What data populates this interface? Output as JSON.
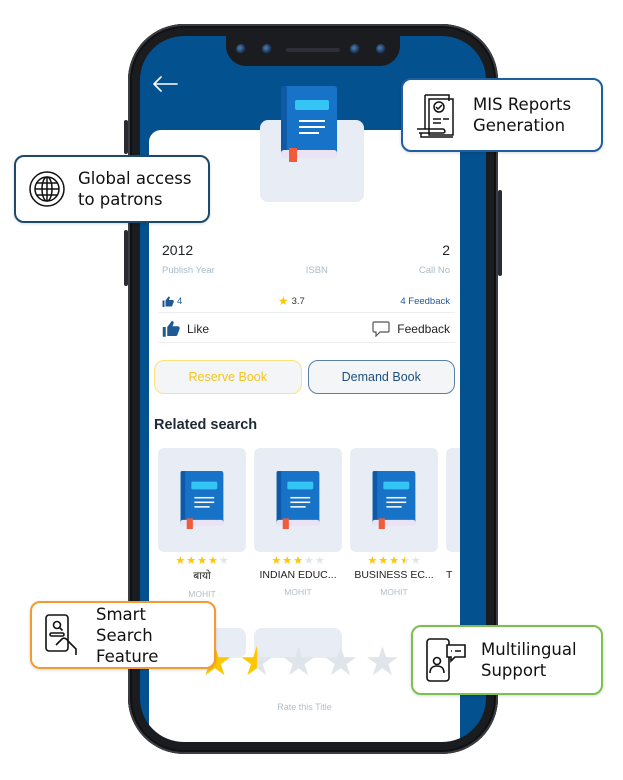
{
  "app": {
    "back_icon": "arrow-left-icon",
    "book": {
      "publish_year": "2012",
      "isbn": "",
      "call_no": "2",
      "labels": {
        "publish_year": "Publish Year",
        "isbn": "ISBN",
        "call_no": "Call No"
      },
      "likes": "4",
      "rating": "3.7",
      "feedback_count": "4 Feedback"
    },
    "actions": {
      "like": "Like",
      "feedback": "Feedback"
    },
    "buttons": {
      "reserve": "Reserve Book",
      "demand": "Demand Book"
    },
    "related": {
      "title": "Related search",
      "items": [
        {
          "title": "बायो",
          "author": "MOHIT",
          "rating": 4
        },
        {
          "title": "INDIAN EDUC...",
          "author": "MOHIT",
          "rating": 3
        },
        {
          "title": "BUSINESS EC...",
          "author": "MOHIT",
          "rating": 3.5
        },
        {
          "title": "T",
          "author": "",
          "rating": 0
        }
      ]
    },
    "user_rating": 1.5,
    "rate_label": "Rate this Title"
  },
  "callouts": {
    "global": {
      "text": "Global access\nto patrons",
      "icon": "globe-icon",
      "color": "#1d4a6b"
    },
    "mis": {
      "text": "MIS Reports\nGeneration",
      "icon": "report-document-icon",
      "color": "#1d5fa0"
    },
    "search": {
      "text": "Smart Search\nFeature",
      "icon": "phone-search-icon",
      "color": "#f39a32"
    },
    "multilingual": {
      "text": "Multilingual\nSupport",
      "icon": "phone-chat-icon",
      "color": "#7cc04f"
    }
  },
  "colors": {
    "brand_blue": "#04518f",
    "star": "#fdc702",
    "reserve": "#f5c518",
    "demand": "#1f4f80"
  }
}
